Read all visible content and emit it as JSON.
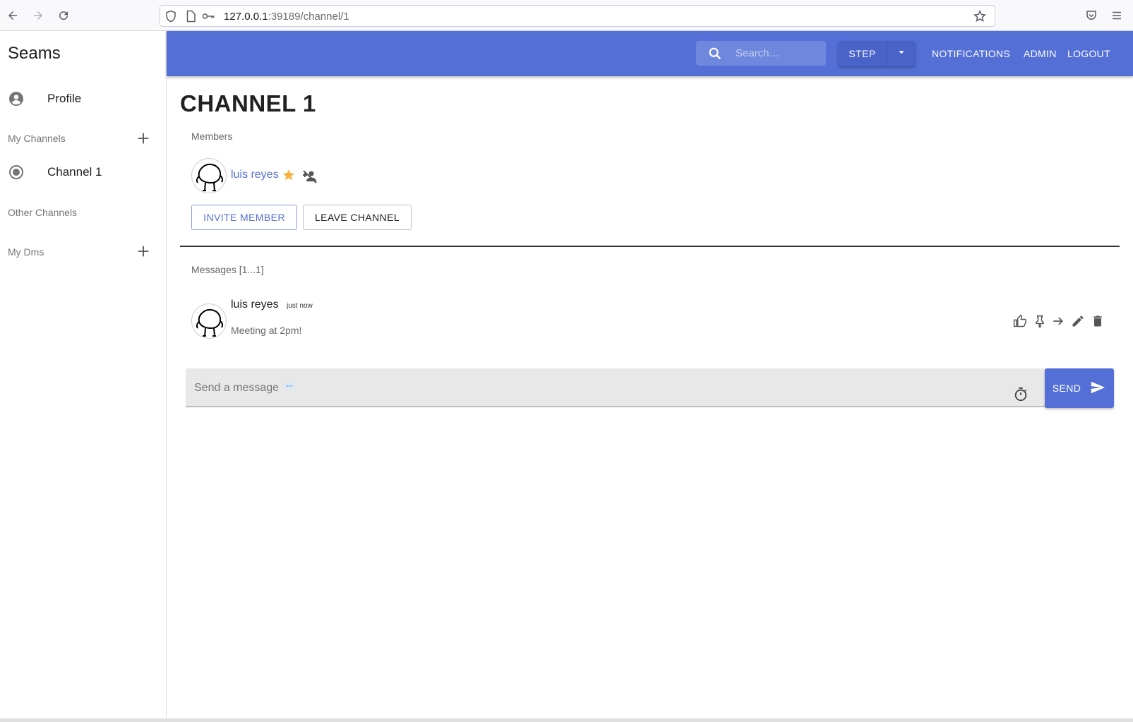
{
  "browser": {
    "url_host": "127.0.0.1",
    "url_path": ":39189/channel/1"
  },
  "sidebar": {
    "brand": "Seams",
    "profile_label": "Profile",
    "my_channels_label": "My Channels",
    "channels": [
      {
        "label": "Channel 1"
      }
    ],
    "other_channels_label": "Other Channels",
    "my_dms_label": "My Dms"
  },
  "appbar": {
    "search_placeholder": "Search…",
    "step_label": "STEP",
    "notifications_label": "NOTIFICATIONS",
    "admin_label": "ADMIN",
    "logout_label": "LOGOUT",
    "color": "#5470d6"
  },
  "channel": {
    "title": "CHANNEL 1",
    "members_label": "Members",
    "members": [
      {
        "name": "luis reyes",
        "is_owner": true
      }
    ],
    "invite_label": "INVITE MEMBER",
    "leave_label": "LEAVE CHANNEL",
    "messages_label": "Messages [1...1]",
    "messages": [
      {
        "author": "luis reyes",
        "time": "just now",
        "text": "Meeting at 2pm!"
      }
    ],
    "composer_placeholder": "Send a message",
    "send_label": "SEND"
  },
  "icons": {
    "star_color": "#f5b342"
  }
}
